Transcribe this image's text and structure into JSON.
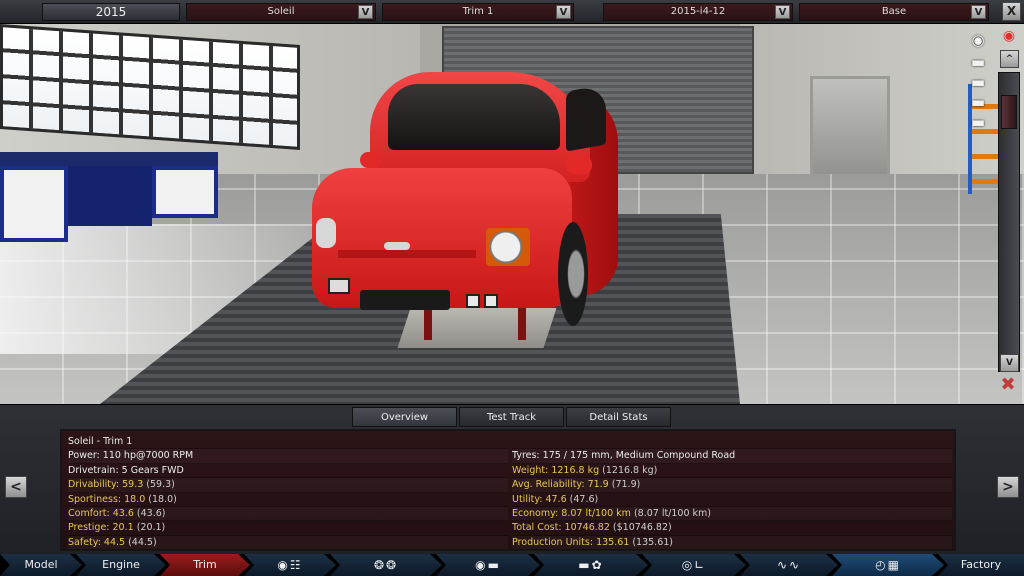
{
  "topbar": {
    "year": "2015",
    "model": "Soleil",
    "trim": "Trim 1",
    "engine": "2015-i4-12",
    "variant": "Base",
    "dropdown_glyph": "V",
    "close_glyph": "X"
  },
  "scene_icons": [
    "camera-icon",
    "car-top-icon",
    "car-side-icon",
    "car-front-icon",
    "car-body-icon"
  ],
  "scrollbar": {
    "up": "^",
    "down": "V"
  },
  "tabs": [
    {
      "label": "Overview",
      "active": true
    },
    {
      "label": "Test Track",
      "active": false
    },
    {
      "label": "Detail Stats",
      "active": false
    }
  ],
  "stats": {
    "title": "Soleil - Trim 1",
    "left": [
      {
        "label": "Power: 110 hp@7000 RPM",
        "extra": "",
        "highlight": false
      },
      {
        "label": "Drivetrain: 5 Gears FWD",
        "extra": "",
        "highlight": false
      },
      {
        "label": "Drivability: 59.3",
        "extra": " (59.3)",
        "highlight": true
      },
      {
        "label": "Sportiness: 18.0",
        "extra": " (18.0)",
        "highlight": true
      },
      {
        "label": "Comfort: 43.6",
        "extra": " (43.6)",
        "highlight": true
      },
      {
        "label": "Prestige: 20.1",
        "extra": " (20.1)",
        "highlight": true
      },
      {
        "label": "Safety: 44.5",
        "extra": " (44.5)",
        "highlight": true
      }
    ],
    "right": [
      {
        "label": "Tyres: 175 / 175 mm, Medium Compound Road",
        "extra": "",
        "highlight": false
      },
      {
        "label": "Weight: 1216.8 kg",
        "extra": " (1216.8 kg)",
        "highlight": true
      },
      {
        "label": "Avg. Reliability: 71.9",
        "extra": " (71.9)",
        "highlight": true
      },
      {
        "label": "Utility: 47.6",
        "extra": " (47.6)",
        "highlight": true
      },
      {
        "label": "Economy: 8.07 lt/100 km",
        "extra": " (8.07 lt/100 km)",
        "highlight": true
      },
      {
        "label": "Total Cost: 10746.82",
        "extra": " ($10746.82)",
        "highlight": true
      },
      {
        "label": "Production Units: 135.61",
        "extra": " (135.61)",
        "highlight": true
      }
    ]
  },
  "side_buttons": {
    "prev": "<",
    "next": ">"
  },
  "nav": {
    "model": "Model",
    "engine": "Engine",
    "trim": "Trim",
    "factory": "Factory"
  },
  "colors": {
    "active_nav": "#9b1c1c",
    "highlight_text": "#e6c94c",
    "car_body": "#e32828"
  }
}
